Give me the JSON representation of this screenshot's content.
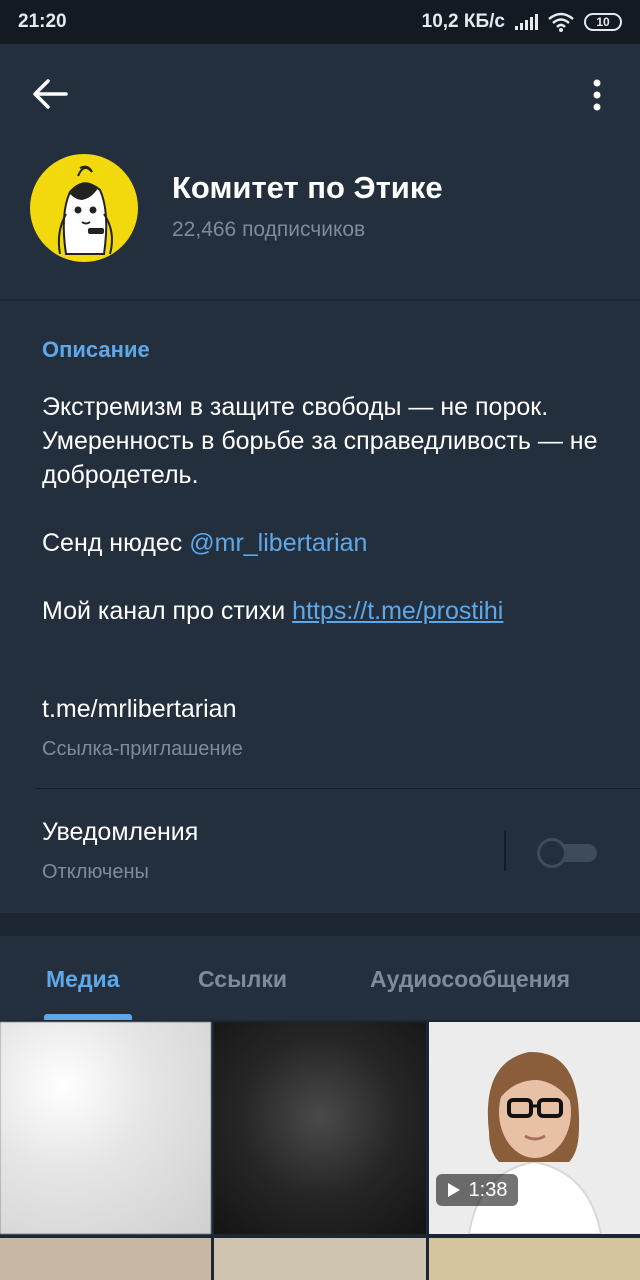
{
  "status_bar": {
    "time": "21:20",
    "network_speed": "10,2 КБ/с",
    "battery": "10",
    "icons": [
      "signal-icon",
      "wifi-icon",
      "battery-icon"
    ]
  },
  "header": {
    "back_icon": "arrow-left-icon",
    "more_icon": "more-vert-icon",
    "title": "Комитет по Этике",
    "subscribers": "22,466 подписчиков"
  },
  "description": {
    "label": "Описание",
    "line1": "Экстремизм в защите свободы — не порок.",
    "line2": "Умеренность в борьбе за справедливость — не добродетель.",
    "send_prefix": "Сенд нюдес ",
    "send_mention": "@mr_libertarian",
    "channel_prefix": "Мой канал про стихи ",
    "channel_url": "https://t.me/prostihi",
    "invite_link": "t.me/mrlibertarian",
    "invite_caption": "Ссылка-приглашение"
  },
  "notifications": {
    "title": "Уведомления",
    "status": "Отключены",
    "enabled": false
  },
  "tabs": [
    {
      "label": "Медиа",
      "active": true
    },
    {
      "label": "Ссылки",
      "active": false
    },
    {
      "label": "Аудиосообщения",
      "active": false
    }
  ],
  "media": {
    "video_duration": "1:38"
  },
  "colors": {
    "accent": "#5ea8ea",
    "background": "#1d2733",
    "panel": "#242f3d",
    "secondary_text": "#7f8b99",
    "avatar_yellow": "#f2d90d"
  }
}
